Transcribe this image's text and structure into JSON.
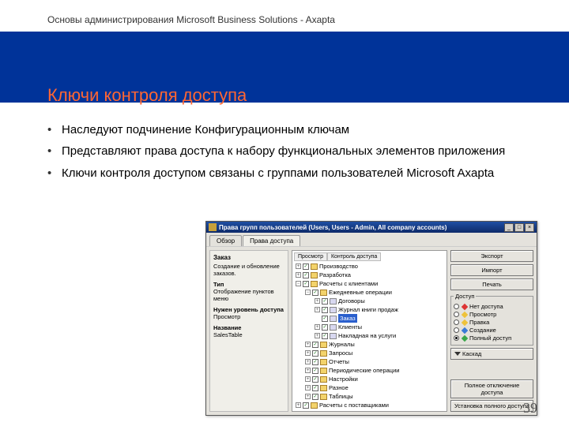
{
  "header": {
    "course": "Основы администрирования Microsoft Business Solutions - Axapta"
  },
  "title": "Ключи контроля доступа",
  "bullets": [
    "Наследуют подчинение Конфигурационным ключам",
    "Представляют права доступа к набору функциональных элементов приложения",
    "Ключи контроля доступом связаны с группами пользователей Microsoft Axapta"
  ],
  "page_number": "39",
  "dialog": {
    "title": "Права групп пользователей (Users, Users - Admin, All company accounts)",
    "window_buttons": [
      "_",
      "□",
      "×"
    ],
    "tabs": [
      "Обзор",
      "Права доступа"
    ],
    "active_tab": 1,
    "left": {
      "section": "Заказ",
      "desc": "Создание и обновление заказов.",
      "type_label": "Тип",
      "type_value": "Отображение пунктов меню",
      "level_label": "Нужен уровень доступа",
      "level_value": "Просмотр",
      "name_label": "Название",
      "name_value": "SalesTable"
    },
    "tree": {
      "headers": [
        "Просмотр",
        "Контроль доступа"
      ],
      "items": [
        {
          "lvl": 0,
          "exp": "+",
          "chk": "✓",
          "icon": "folder",
          "label": "Производство"
        },
        {
          "lvl": 0,
          "exp": "+",
          "chk": "✓",
          "icon": "folder",
          "label": "Разработка"
        },
        {
          "lvl": 0,
          "exp": "−",
          "chk": "✓",
          "icon": "folder",
          "label": "Расчеты с клиентами"
        },
        {
          "lvl": 1,
          "exp": "−",
          "chk": "✓",
          "icon": "folder",
          "label": "Ежедневные операции"
        },
        {
          "lvl": 2,
          "exp": "+",
          "chk": "✓",
          "icon": "key",
          "label": "Договоры"
        },
        {
          "lvl": 2,
          "exp": "+",
          "chk": "✓",
          "icon": "key",
          "label": "Журнал книги продаж"
        },
        {
          "lvl": 2,
          "exp": "",
          "chk": "✓",
          "icon": "key",
          "label": "Заказ",
          "sel": true
        },
        {
          "lvl": 2,
          "exp": "+",
          "chk": "✓",
          "icon": "key",
          "label": "Клиенты"
        },
        {
          "lvl": 2,
          "exp": "+",
          "chk": "✓",
          "icon": "key",
          "label": "Накладная на услуги"
        },
        {
          "lvl": 1,
          "exp": "+",
          "chk": "✓",
          "icon": "folder",
          "label": "Журналы"
        },
        {
          "lvl": 1,
          "exp": "+",
          "chk": "✓",
          "icon": "folder",
          "label": "Запросы"
        },
        {
          "lvl": 1,
          "exp": "+",
          "chk": "✓",
          "icon": "folder",
          "label": "Отчеты"
        },
        {
          "lvl": 1,
          "exp": "+",
          "chk": "✓",
          "icon": "folder",
          "label": "Периодические операции"
        },
        {
          "lvl": 1,
          "exp": "+",
          "chk": "✓",
          "icon": "folder",
          "label": "Настройки"
        },
        {
          "lvl": 1,
          "exp": "+",
          "chk": "✓",
          "icon": "folder",
          "label": "Разное"
        },
        {
          "lvl": 1,
          "exp": "+",
          "chk": "✓",
          "icon": "folder",
          "label": "Таблицы"
        },
        {
          "lvl": 0,
          "exp": "+",
          "chk": "✓",
          "icon": "folder",
          "label": "Расчеты с поставщиками"
        }
      ]
    },
    "access": {
      "legend": "Доступ",
      "options": [
        {
          "label": "Нет доступа",
          "color": "red",
          "sel": false
        },
        {
          "label": "Просмотр",
          "color": "yellow",
          "sel": false
        },
        {
          "label": "Правка",
          "color": "yellow",
          "sel": false
        },
        {
          "label": "Создание",
          "color": "blue",
          "sel": false
        },
        {
          "label": "Полный доступ",
          "color": "green",
          "sel": true
        }
      ]
    },
    "buttons": {
      "export": "Экспорт",
      "import": "Импорт",
      "print": "Печать",
      "cascade": "Каскад",
      "disable_all": "Полное отключение доступа",
      "enable_all": "Установка полного доступа"
    }
  }
}
